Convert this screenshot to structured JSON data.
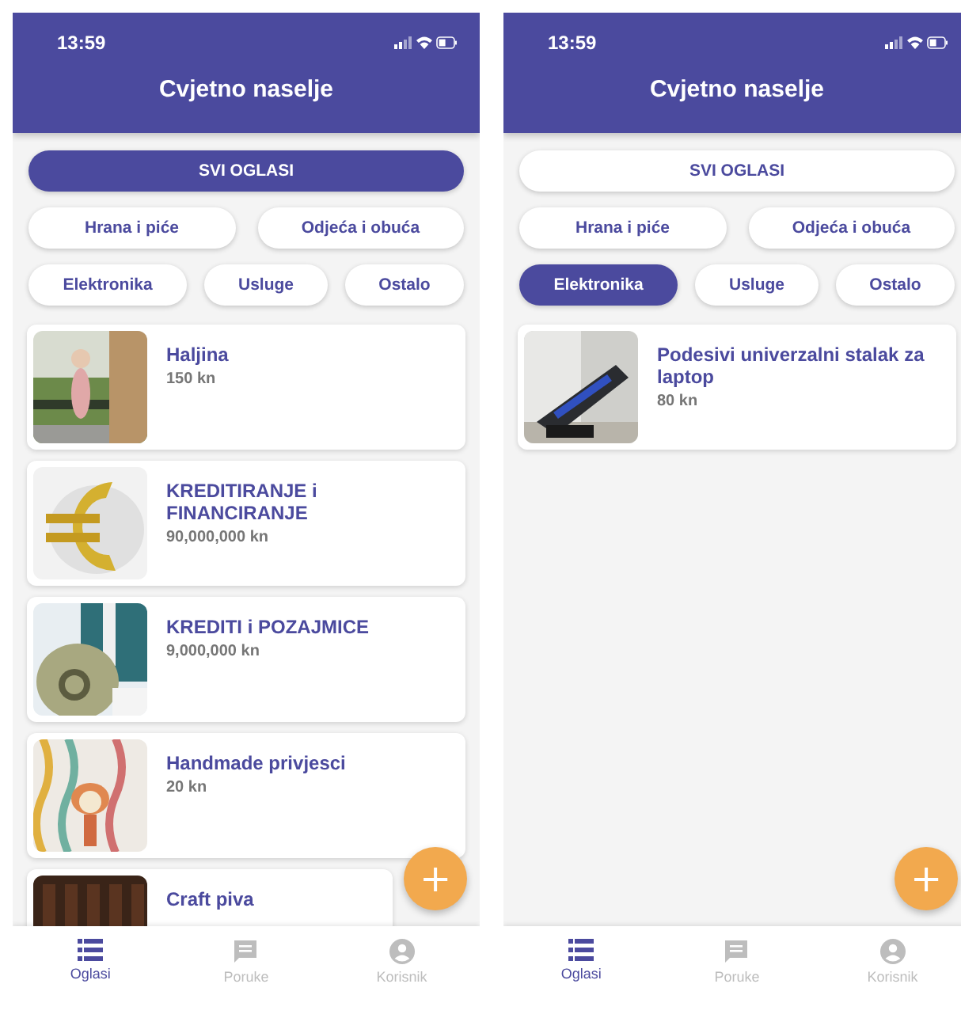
{
  "screens": [
    {
      "status_bar": {
        "time": "13:59"
      },
      "title": "Cvjetno naselje",
      "filter_rows": [
        [
          {
            "label": "SVI OGLASI",
            "selected": true
          }
        ],
        [
          {
            "label": "Hrana i piće",
            "selected": false
          },
          {
            "label": "Odjeća i obuća",
            "selected": false
          }
        ],
        [
          {
            "label": "Elektronika",
            "selected": false
          },
          {
            "label": "Usluge",
            "selected": false
          },
          {
            "label": "Ostalo",
            "selected": false
          }
        ]
      ],
      "listings": [
        {
          "title": "Haljina",
          "price": "150 kn"
        },
        {
          "title": "KREDITIRANJE  i FINANCIRANJE",
          "price": "90,000,000 kn"
        },
        {
          "title": "KREDITI  i  POZAJMICE",
          "price": "9,000,000 kn"
        },
        {
          "title": "Handmade privjesci",
          "price": "20 kn"
        },
        {
          "title": "Craft piva"
        }
      ],
      "fab": "+",
      "nav": [
        {
          "kind": "list",
          "label": "Oglasi",
          "selected": true
        },
        {
          "kind": "chat",
          "label": "Poruke",
          "selected": false
        },
        {
          "kind": "user",
          "label": "Korisnik",
          "selected": false
        }
      ]
    },
    {
      "status_bar": {
        "time": "13:59"
      },
      "title": "Cvjetno naselje",
      "filter_rows": [
        [
          {
            "label": "SVI OGLASI",
            "selected": false
          }
        ],
        [
          {
            "label": "Hrana i piće",
            "selected": false
          },
          {
            "label": "Odjeća i obuća",
            "selected": false
          }
        ],
        [
          {
            "label": "Elektronika",
            "selected": true
          },
          {
            "label": "Usluge",
            "selected": false
          },
          {
            "label": "Ostalo",
            "selected": false
          }
        ]
      ],
      "listings": [
        {
          "title": "Podesivi univerzalni stalak za laptop",
          "price": "80 kn"
        }
      ],
      "fab": "+",
      "nav": [
        {
          "kind": "list",
          "label": "Oglasi",
          "selected": true
        },
        {
          "kind": "chat",
          "label": "Poruke",
          "selected": false
        },
        {
          "kind": "user",
          "label": "Korisnik",
          "selected": false
        }
      ]
    }
  ]
}
